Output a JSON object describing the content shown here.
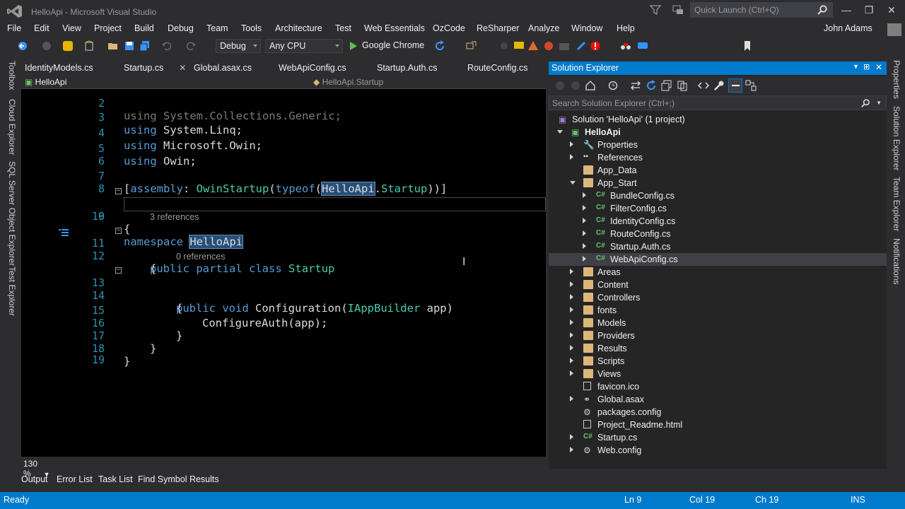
{
  "window": {
    "title": "HelloApi - Microsoft Visual Studio",
    "quick_launch_placeholder": "Quick Launch (Ctrl+Q)",
    "user": "John Adams"
  },
  "menu": [
    "File",
    "Edit",
    "View",
    "Project",
    "Build",
    "Debug",
    "Team",
    "Tools",
    "Architecture",
    "Test",
    "Web Essentials",
    "OzCode",
    "ReSharper",
    "Analyze",
    "Window",
    "Help"
  ],
  "toolbar": {
    "config": "Debug",
    "platform": "Any CPU",
    "browser": "Google Chrome"
  },
  "left_tool_tabs": [
    "Toolbox",
    "Cloud Explorer",
    "SQL Server Object Explorer",
    "Test Explorer"
  ],
  "right_tool_tabs": [
    "Properties",
    "Solution Explorer",
    "Team Explorer",
    "Notifications"
  ],
  "doc_tabs": [
    {
      "label": "IdentityModels.cs"
    },
    {
      "label": "Startup.cs",
      "close": "✕"
    },
    {
      "label": "Global.asax.cs"
    },
    {
      "label": "WebApiConfig.cs"
    },
    {
      "label": "Startup.Auth.cs"
    },
    {
      "label": "RouteConfig.cs"
    }
  ],
  "navbar": {
    "project": "HelloApi",
    "member": "HelloApi.Startup"
  },
  "editor": {
    "line_numbers": [
      "2",
      "3",
      "4",
      "5",
      "6",
      "7",
      "8",
      "9",
      "10",
      "11",
      "12",
      "13",
      "14",
      "15",
      "16",
      "17",
      "18",
      "19"
    ],
    "line2": "using System.Collections.Generic;",
    "line3_kw": "using",
    "line3_rest": " System.Linq;",
    "line4_kw": "using",
    "line4_rest": " Microsoft.Owin;",
    "line5_kw": "using",
    "line5_rest": " Owin;",
    "line7": {
      "p1": "[",
      "kw1": "assembly",
      "p2": ": ",
      "ty1": "OwinStartup",
      "p3": "(",
      "kw2": "typeof",
      "p4": "(",
      "hl": "HelloApi",
      "p5": ".",
      "ty2": "Startup",
      "p6": "))]"
    },
    "line9": {
      "kw": "namespace",
      "sp": " ",
      "hl": "HelloApi"
    },
    "line10": "{",
    "lens1": "3 references",
    "line11": {
      "kw1": "public",
      "kw2": "partial",
      "kw3": "class",
      "ty": "Startup"
    },
    "line12": "{",
    "lens2": "0 references",
    "line13": {
      "kw1": "public",
      "kw2": "void",
      "name": " Configuration(",
      "ty": "IAppBuilder",
      "rest": " app)"
    },
    "line14": "{",
    "line15": "ConfigureAuth(app);",
    "line16": "}",
    "line17": "}",
    "line18": "}"
  },
  "zoom": "130 %",
  "bottom_tabs": [
    "Output",
    "Error List",
    "Task List",
    "Find Symbol Results"
  ],
  "status": {
    "ready": "Ready",
    "ln": "Ln 9",
    "col": "Col 19",
    "ch": "Ch 19",
    "mode": "INS"
  },
  "solution_explorer": {
    "title": "Solution Explorer",
    "search_placeholder": "Search Solution Explorer (Ctrl+;)",
    "solution": "Solution 'HelloApi' (1 project)",
    "project": "HelloApi",
    "items": [
      {
        "label": "Properties"
      },
      {
        "label": "References"
      },
      {
        "label": "App_Data"
      },
      {
        "label": "App_Start"
      },
      {
        "label": "BundleConfig.cs"
      },
      {
        "label": "FilterConfig.cs"
      },
      {
        "label": "IdentityConfig.cs"
      },
      {
        "label": "RouteConfig.cs"
      },
      {
        "label": "Startup.Auth.cs"
      },
      {
        "label": "WebApiConfig.cs"
      },
      {
        "label": "Areas"
      },
      {
        "label": "Content"
      },
      {
        "label": "Controllers"
      },
      {
        "label": "fonts"
      },
      {
        "label": "Models"
      },
      {
        "label": "Providers"
      },
      {
        "label": "Results"
      },
      {
        "label": "Scripts"
      },
      {
        "label": "Views"
      },
      {
        "label": "favicon.ico"
      },
      {
        "label": "Global.asax"
      },
      {
        "label": "packages.config"
      },
      {
        "label": "Project_Readme.html"
      },
      {
        "label": "Startup.cs"
      },
      {
        "label": "Web.config"
      }
    ]
  },
  "colors": {
    "accent": "#007acc",
    "keyword": "#569cd6",
    "type": "#4ec9b0",
    "line_number": "#2b91af",
    "folder": "#dcb67a",
    "background": "#2d2d30"
  }
}
